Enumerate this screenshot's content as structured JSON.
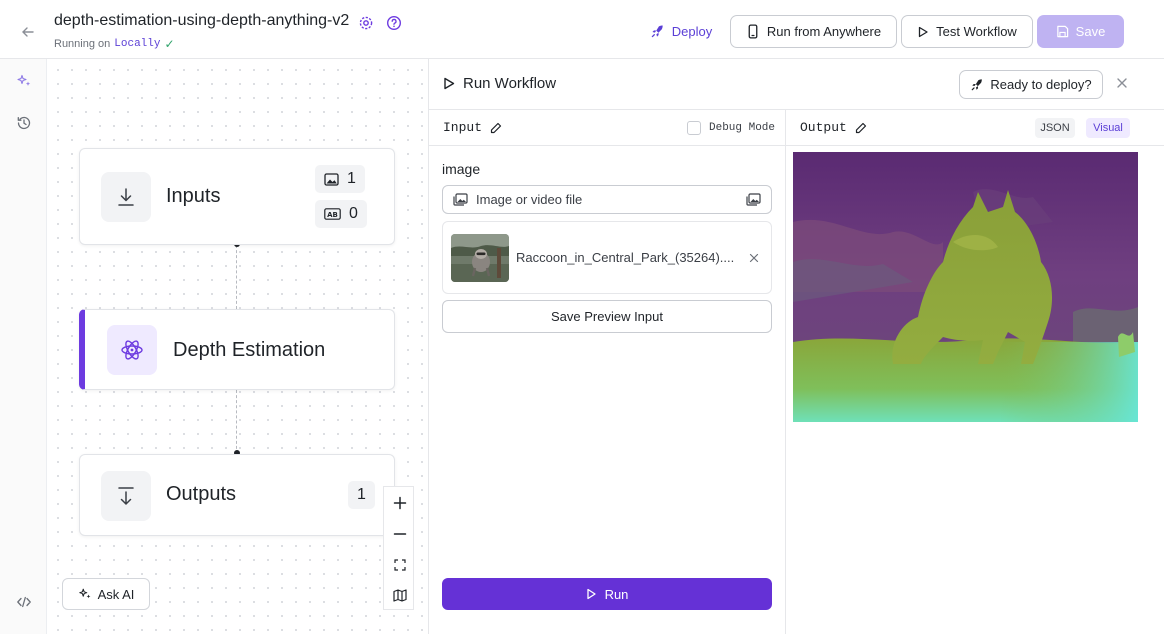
{
  "header": {
    "title": "depth-estimation-using-depth-anything-v2",
    "status_prefix": "Running on",
    "status_location": "Locally",
    "deploy_label": "Deploy",
    "run_anywhere_label": "Run from Anywhere",
    "test_label": "Test Workflow",
    "save_label": "Save"
  },
  "canvas": {
    "nodes": [
      {
        "label": "Inputs",
        "badges": [
          {
            "icon": "image-icon",
            "value": "1"
          },
          {
            "icon": "text-ab-icon",
            "value": "0"
          }
        ]
      },
      {
        "label": "Depth Estimation",
        "icon": "atom-icon"
      },
      {
        "label": "Outputs",
        "badge": "1"
      }
    ],
    "ask_ai_label": "Ask AI"
  },
  "panel": {
    "title": "Run Workflow",
    "ready_label": "Ready to deploy?",
    "input": {
      "heading": "Input",
      "debug_label": "Debug Mode",
      "field_label": "image",
      "file_placeholder": "Image or video file",
      "file_name": "Raccoon_in_Central_Park_(35264)....",
      "save_preview_label": "Save Preview Input",
      "run_label": "Run"
    },
    "output": {
      "heading": "Output",
      "tab_json": "JSON",
      "tab_visual": "Visual"
    }
  },
  "colors": {
    "accent": "#6531d6",
    "accent_light": "#bfb3f2",
    "node_selected_bar": "#6d3be0"
  }
}
